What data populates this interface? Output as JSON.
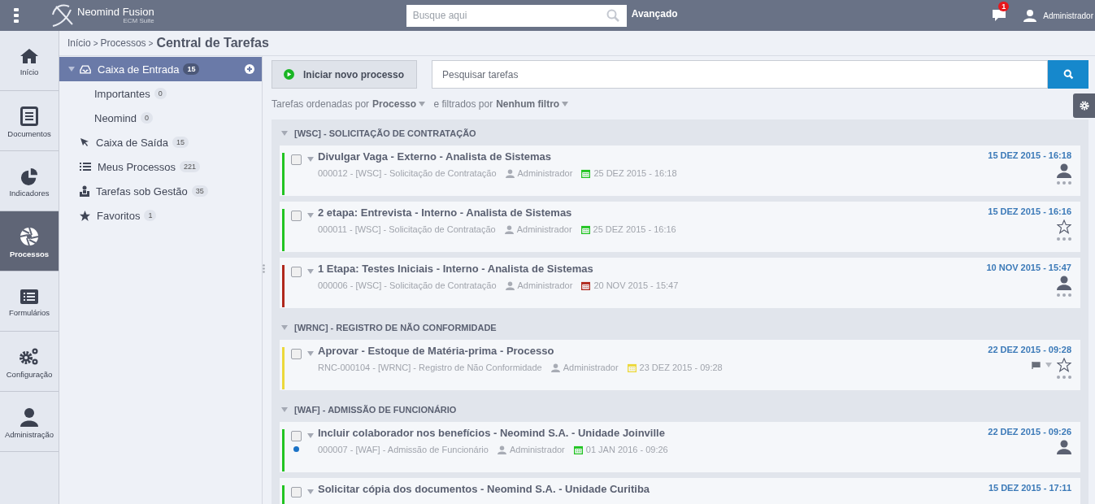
{
  "topbar": {
    "logo": "Neomind Fusion",
    "logo_sub": "ECM Suite",
    "search": {
      "placeholder": "Busque aqui"
    },
    "advanced": "Avançado",
    "notifications": "1",
    "user": "Administrador"
  },
  "nav": [
    {
      "label": "Início",
      "kind": "home",
      "selected": false
    },
    {
      "label": "Documentos",
      "kind": "document",
      "selected": false
    },
    {
      "label": "Indicadores",
      "kind": "pie",
      "selected": false
    },
    {
      "label": "Processos",
      "kind": "aperture",
      "selected": true
    },
    {
      "label": "Formulários",
      "kind": "form",
      "selected": false
    },
    {
      "label": "Configuração",
      "kind": "gears",
      "selected": false
    },
    {
      "label": "Administração",
      "kind": "user",
      "selected": false
    }
  ],
  "breadcrumb": [
    {
      "label": "Início",
      "separator": ">"
    },
    {
      "label": "Processos",
      "separator": ">"
    }
  ],
  "page_title": "Central de Tarefas",
  "tree": [
    {
      "label": "Caixa de Entrada",
      "count": "15",
      "kind": "inbox",
      "selected": true,
      "expanded": true,
      "children": [
        {
          "label": "Importantes",
          "count": "0",
          "selected": false
        },
        {
          "label": "Neomind",
          "count": "0",
          "selected": false
        }
      ]
    },
    {
      "label": "Caixa de Saída",
      "count": "15",
      "kind": "cursor",
      "selected": false
    },
    {
      "label": "Meus Processos",
      "count": "221",
      "kind": "list",
      "selected": false
    },
    {
      "label": "Tarefas sob Gestão",
      "count": "35",
      "kind": "manager",
      "selected": false
    },
    {
      "label": "Favoritos",
      "count": "1",
      "kind": "star",
      "selected": false
    }
  ],
  "new_process_button": "Iniciar novo processo",
  "task_search": {
    "placeholder": "Pesquisar tarefas"
  },
  "sort": {
    "prefix": "Tarefas ordenadas por",
    "sort_by": "Processo",
    "middle": "e filtrados por",
    "filter": "Nenhum filtro"
  },
  "groups": [
    {
      "title": "[WSC] - SOLICITAÇÃO DE CONTRATAÇÃO",
      "expanded": true,
      "tasks": [
        {
          "title": "Divulgar Vaga - Externo - Analista de Sistemas",
          "code": "000012 - [WSC] - Solicitação de Contratação",
          "assignee": "Administrador",
          "due": "25 DEZ 2015 - 16:18",
          "color": "#22c422",
          "date": "15 DEZ 2015 - 16:18",
          "kind": "person",
          "more": true,
          "unread": false,
          "checked": false
        },
        {
          "title": "2 etapa: Entrevista - Interno - Analista de Sistemas",
          "code": "000011 - [WSC] - Solicitação de Contratação",
          "assignee": "Administrador",
          "due": "25 DEZ 2015 - 16:16",
          "color": "#22c422",
          "date": "15 DEZ 2015 - 16:16",
          "kind": "star",
          "more": true,
          "unread": false,
          "checked": false
        },
        {
          "title": "1 Etapa: Testes Iniciais - Interno - Analista de Sistemas",
          "code": "000006 - [WSC] - Solicitação de Contratação",
          "assignee": "Administrador",
          "due": "20 NOV 2015 - 15:47",
          "color": "#b0281c",
          "date": "10 NOV 2015 - 15:47",
          "kind": "person",
          "more": true,
          "unread": false,
          "checked": false
        }
      ]
    },
    {
      "title": "[WRNC] - REGISTRO DE NÃO CONFORMIDADE",
      "expanded": true,
      "tasks": [
        {
          "title": "Aprovar - Estoque de Matéria-prima - Processo",
          "code": "RNC-000104 - [WRNC] - Registro de Não Conformidade",
          "assignee": "Administrador",
          "due": "23 DEZ 2015 - 09:28",
          "color": "#ecd83a",
          "date": "22 DEZ 2015 - 09:28",
          "kind": "flag_star",
          "more": true,
          "unread": false,
          "checked": false
        }
      ]
    },
    {
      "title": "[WAF] - ADMISSÃO DE FUNCIONÁRIO",
      "expanded": true,
      "tasks": [
        {
          "title": "Incluir colaborador nos benefícios - Neomind S.A. - Unidade Joinville",
          "code": "000007 - [WAF] - Admissão de Funcionário",
          "assignee": "Administrador",
          "due": "01 JAN 2016 - 09:26",
          "color": "#22c422",
          "date": "22 DEZ 2015 - 09:26",
          "kind": "person",
          "more": false,
          "unread": true,
          "checked": false
        },
        {
          "title": "Solicitar cópia dos documentos - Neomind S.A. - Unidade Curitiba",
          "color": "#22c422",
          "date": "15 DEZ 2015 - 17:11",
          "more": false,
          "unread": false,
          "checked": false
        }
      ]
    }
  ]
}
